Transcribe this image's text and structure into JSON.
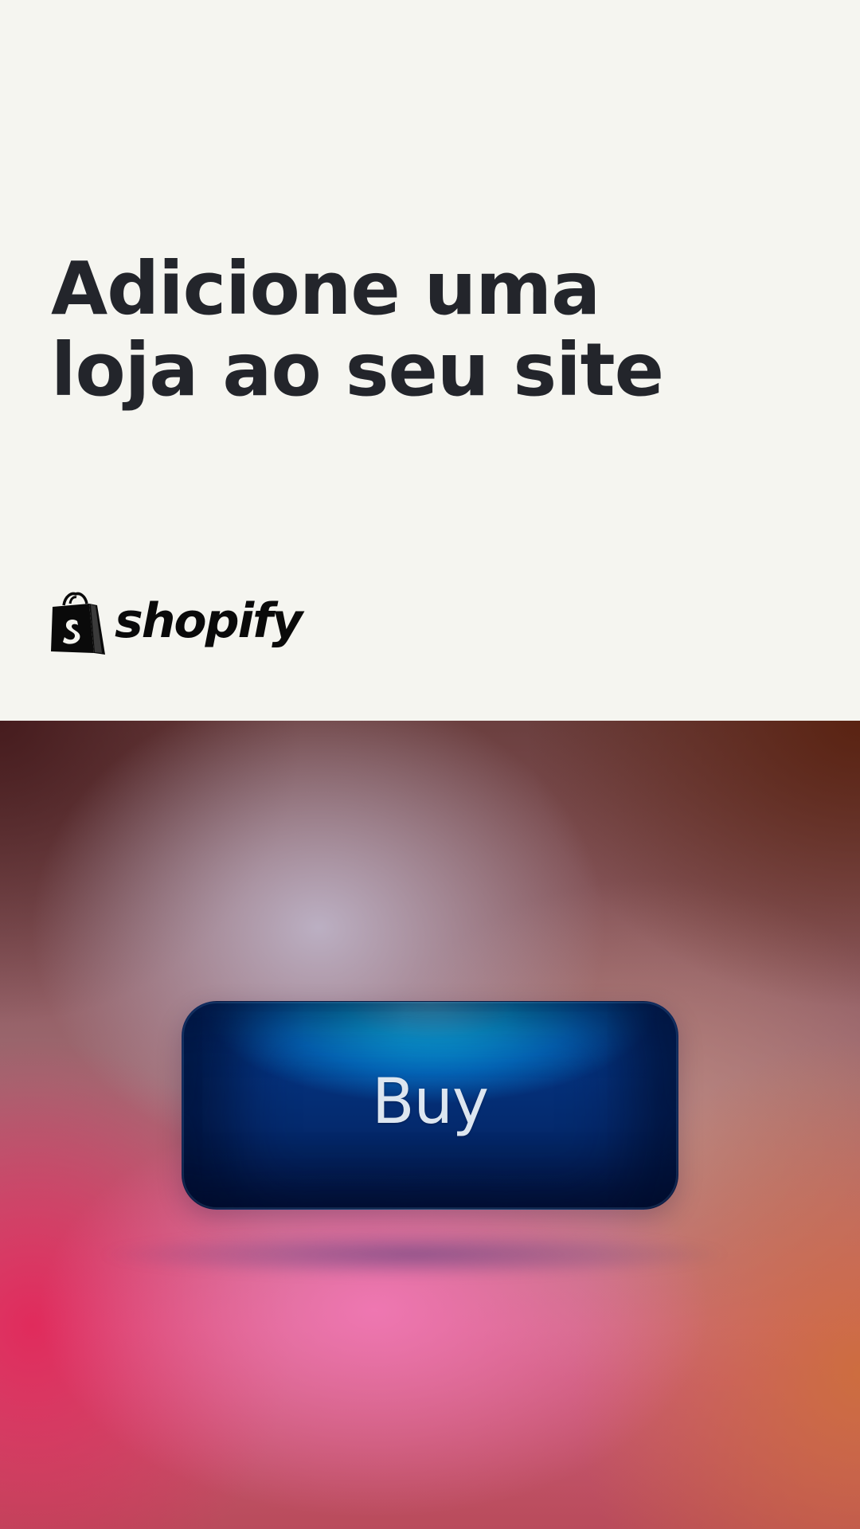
{
  "headline": {
    "line1": "Adicione uma",
    "line2": "loja ao seu site"
  },
  "brand": {
    "name": "shopify",
    "icon": "shopify-bag-icon"
  },
  "cta": {
    "label": "Buy"
  },
  "colors": {
    "top_background": "#f5f5f0",
    "headline_text": "#23252b",
    "button_blue": "#0566b8",
    "button_dark": "#031540"
  }
}
